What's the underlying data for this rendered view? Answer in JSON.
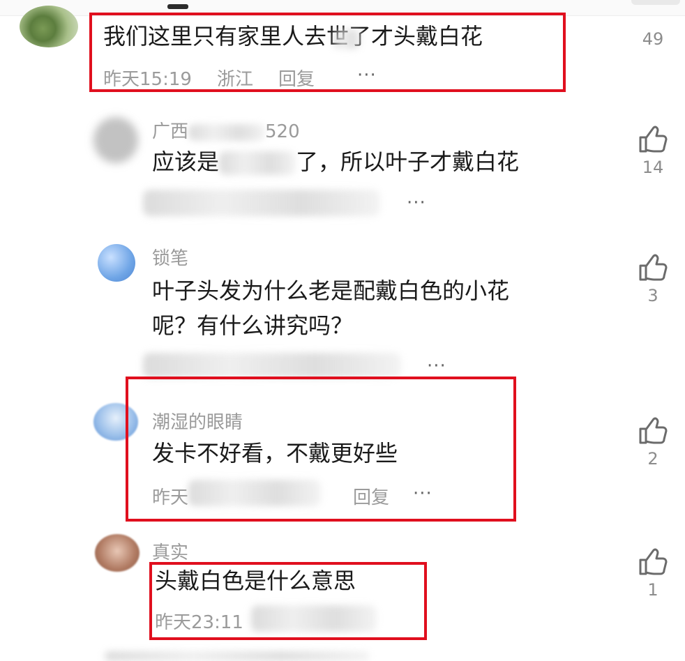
{
  "accent_color": "#e00f1e",
  "comments": [
    {
      "text": "我们这里只有家里人去世了才头戴白花",
      "meta_time": "昨天15:19",
      "meta_location": "浙江",
      "reply_label": "回复",
      "more": "···",
      "likes": "49"
    },
    {
      "name": "广西",
      "name_tail": "520",
      "text": "应该是",
      "text_tail": "了，所以叶子才戴白花",
      "more": "···",
      "likes": "14"
    },
    {
      "name": "锁笔",
      "text_line1": "叶子头发为什么老是配戴白色的小花",
      "text_line2": "呢？有什么讲究吗？",
      "more": "···",
      "likes": "3"
    },
    {
      "name": "潮湿的眼睛",
      "text": "发卡不好看，不戴更好些",
      "meta_time": "昨天",
      "reply_label": "回复",
      "more": "···",
      "likes": "2"
    },
    {
      "name": "真实",
      "text": "头戴白色是什么意思",
      "meta_time": "昨天23:11",
      "likes": "1"
    }
  ]
}
